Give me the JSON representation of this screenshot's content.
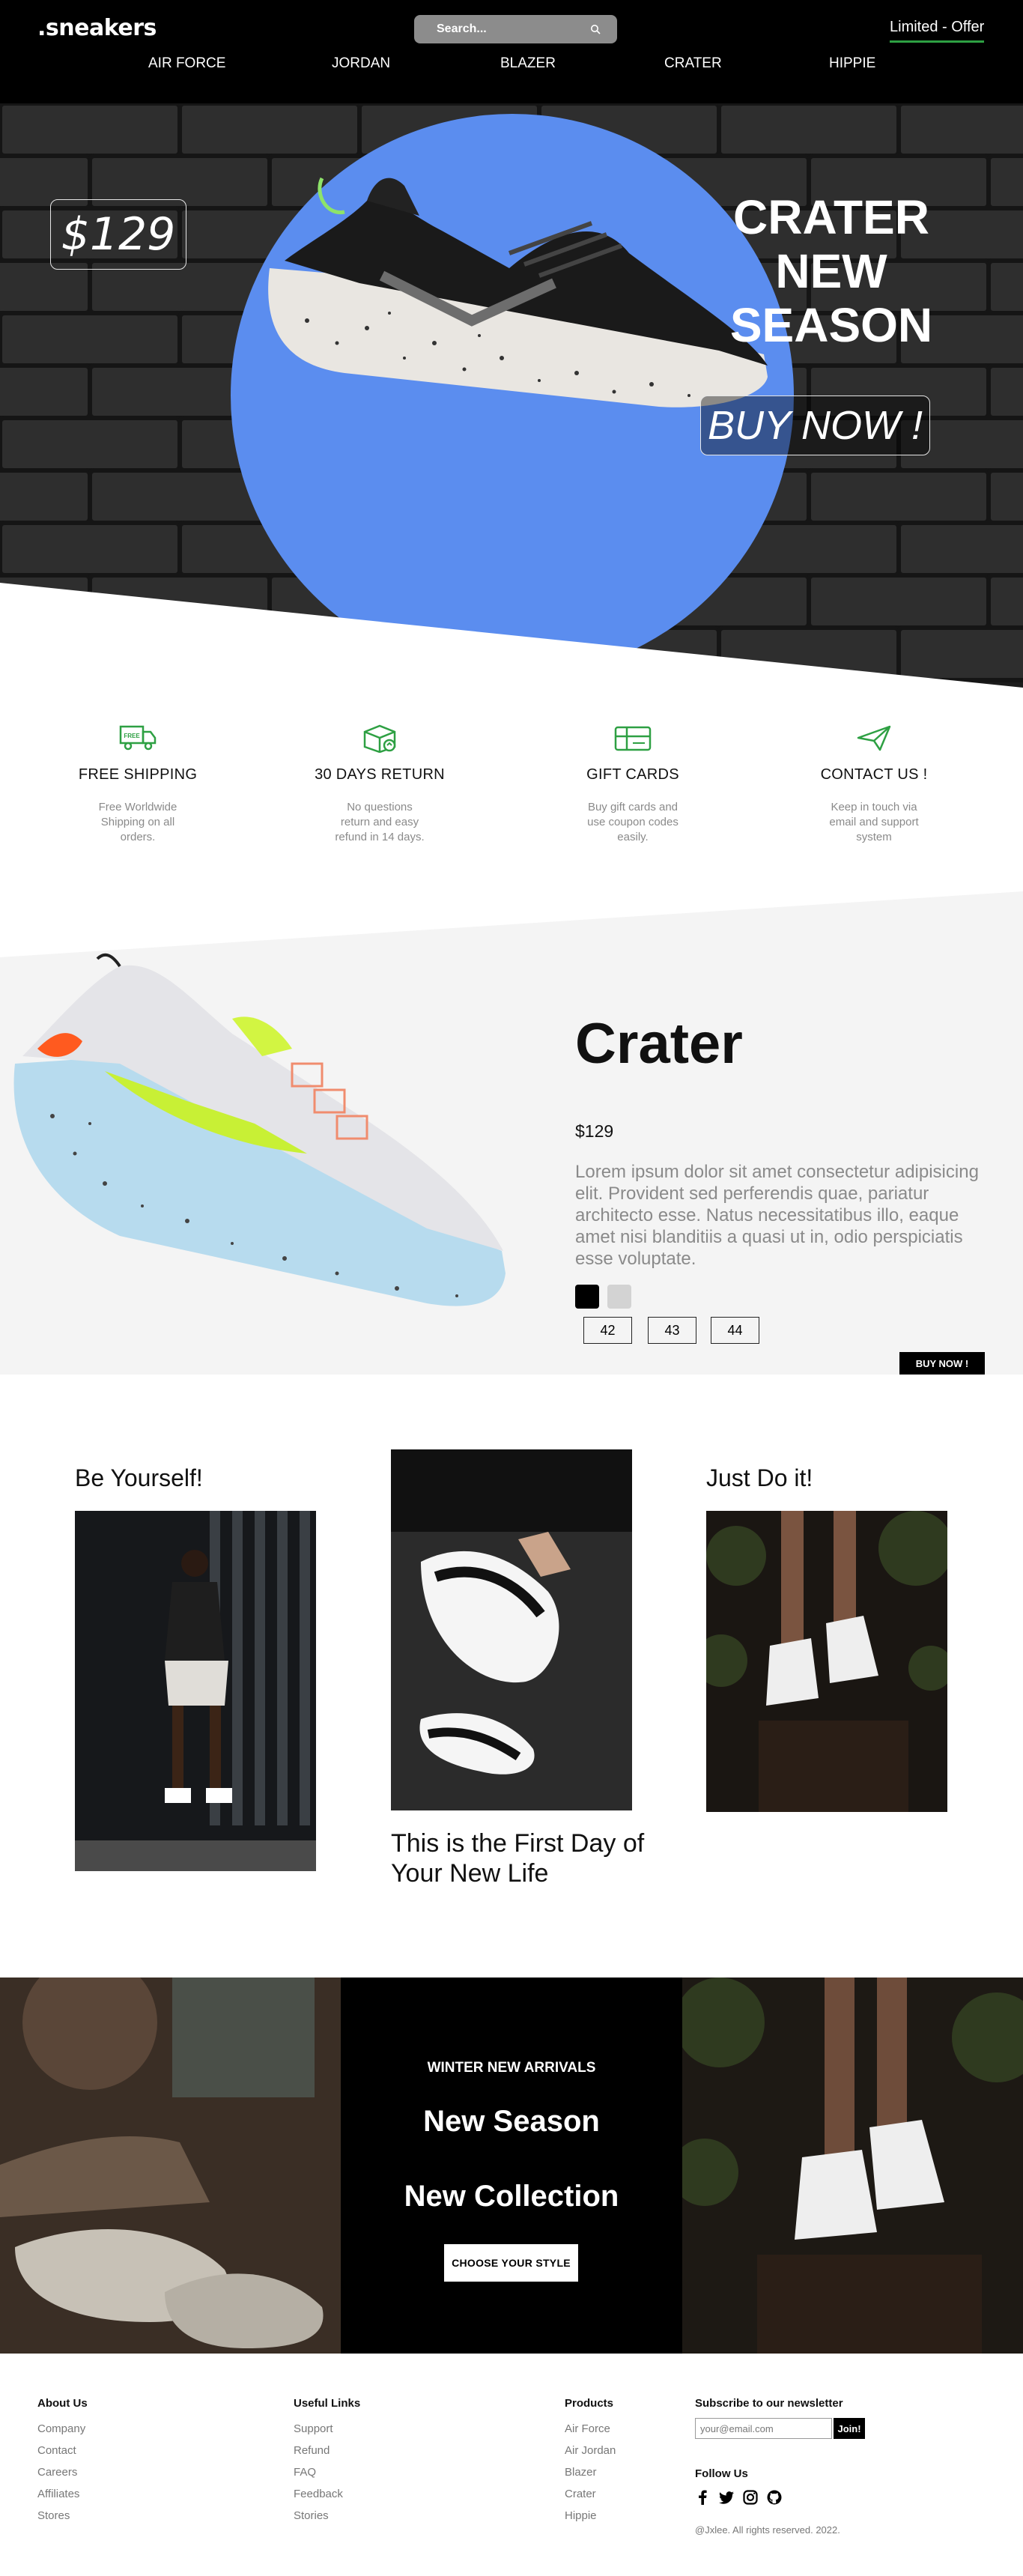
{
  "header": {
    "logo": ".sneakers",
    "search_placeholder": "Search...",
    "offer": "Limited - Offer",
    "menu": [
      "AIR FORCE",
      "JORDAN",
      "BLAZER",
      "CRATER",
      "HIPPIE"
    ]
  },
  "hero": {
    "price": "$129",
    "title_lines": [
      "CRATER",
      "NEW",
      "SEASON"
    ],
    "buy": "BUY NOW !"
  },
  "features": [
    {
      "icon": "truck-icon",
      "badge": "FREE",
      "title": "FREE SHIPPING",
      "text": "Free Worldwide Shipping on all orders."
    },
    {
      "icon": "return-box-icon",
      "title": "30 DAYS RETURN",
      "text": "No questions return and easy refund in 14 days."
    },
    {
      "icon": "gift-card-icon",
      "title": "GIFT CARDS",
      "text": "Buy gift cards and use coupon codes easily."
    },
    {
      "icon": "paper-plane-icon",
      "title": "CONTACT US !",
      "text": "Keep in touch via email and support system"
    }
  ],
  "product": {
    "name": "Crater",
    "price": "$129",
    "description": "Lorem ipsum dolor sit amet consectetur adipisicing elit. Provident sed perferendis quae, pariatur architecto esse. Natus necessitatibus illo, eaque amet nisi blanditiis a quasi ut in, odio perspiciatis esse voluptate.",
    "colors": [
      "#000000",
      "#d3d3d3"
    ],
    "sizes": [
      "42",
      "43",
      "44"
    ],
    "buy": "BUY NOW !"
  },
  "gallery": {
    "left_title": "Be Yourself!",
    "center_caption": "This is the First Day of Your New Life",
    "right_title": "Just Do it!"
  },
  "banner": {
    "subtitle": "WINTER NEW ARRIVALS",
    "line1": "New Season",
    "line2": "New Collection",
    "button": "CHOOSE YOUR STYLE"
  },
  "footer": {
    "about": {
      "title": "About Us",
      "links": [
        "Company",
        "Contact",
        "Careers",
        "Affiliates",
        "Stores"
      ]
    },
    "useful": {
      "title": "Useful Links",
      "links": [
        "Support",
        "Refund",
        "FAQ",
        "Feedback",
        "Stories"
      ]
    },
    "products": {
      "title": "Products",
      "links": [
        "Air Force",
        "Air Jordan",
        "Blazer",
        "Crater",
        "Hippie"
      ]
    },
    "newsletter_title": "Subscribe to our newsletter",
    "email_placeholder": "your@email.com",
    "join": "Join!",
    "follow": "Follow Us",
    "socials": [
      "facebook-icon",
      "twitter-icon",
      "instagram-icon",
      "github-icon"
    ],
    "copyright": "@Jxlee. All rights reserved. 2022."
  }
}
